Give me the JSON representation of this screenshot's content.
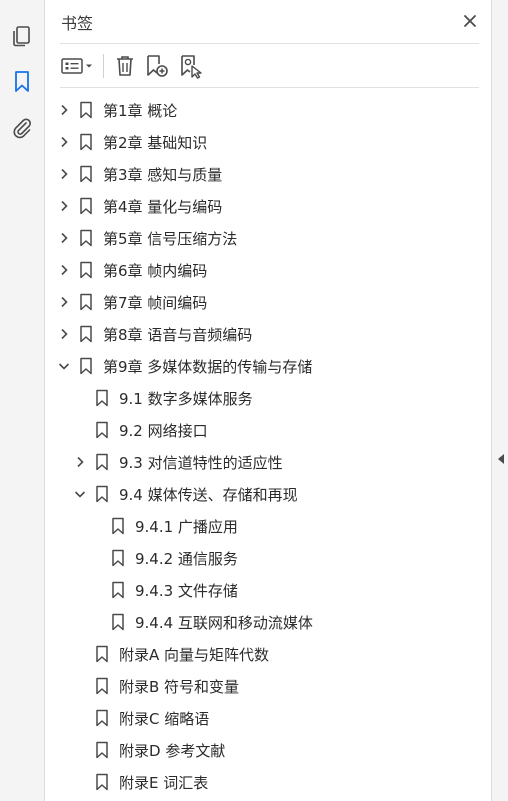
{
  "panel": {
    "title": "书签"
  },
  "bookmarks": [
    {
      "label": "第1章 概论",
      "level": 0,
      "state": "collapsed"
    },
    {
      "label": "第2章 基础知识",
      "level": 0,
      "state": "collapsed"
    },
    {
      "label": "第3章 感知与质量",
      "level": 0,
      "state": "collapsed"
    },
    {
      "label": "第4章 量化与编码",
      "level": 0,
      "state": "collapsed"
    },
    {
      "label": "第5章 信号压缩方法",
      "level": 0,
      "state": "collapsed"
    },
    {
      "label": "第6章 帧内编码",
      "level": 0,
      "state": "collapsed"
    },
    {
      "label": "第7章 帧间编码",
      "level": 0,
      "state": "collapsed"
    },
    {
      "label": "第8章 语音与音频编码",
      "level": 0,
      "state": "collapsed"
    },
    {
      "label": "第9章 多媒体数据的传输与存储",
      "level": 0,
      "state": "expanded"
    },
    {
      "label": "9.1 数字多媒体服务",
      "level": 1,
      "state": "leaf"
    },
    {
      "label": "9.2 网络接口",
      "level": 1,
      "state": "leaf"
    },
    {
      "label": "9.3 对信道特性的适应性",
      "level": 1,
      "state": "collapsed"
    },
    {
      "label": "9.4 媒体传送、存储和再现",
      "level": 1,
      "state": "expanded"
    },
    {
      "label": "9.4.1 广播应用",
      "level": 2,
      "state": "leaf"
    },
    {
      "label": "9.4.2 通信服务",
      "level": 2,
      "state": "leaf"
    },
    {
      "label": "9.4.3 文件存储",
      "level": 2,
      "state": "leaf"
    },
    {
      "label": "9.4.4 互联网和移动流媒体",
      "level": 2,
      "state": "leaf"
    },
    {
      "label": "附录A  向量与矩阵代数",
      "level": 1,
      "state": "leaf"
    },
    {
      "label": "附录B  符号和变量",
      "level": 1,
      "state": "leaf"
    },
    {
      "label": "附录C  缩略语",
      "level": 1,
      "state": "leaf"
    },
    {
      "label": "附录D  参考文献",
      "level": 1,
      "state": "leaf"
    },
    {
      "label": "附录E  词汇表",
      "level": 1,
      "state": "leaf"
    }
  ],
  "icons": {
    "rail": [
      "pages-icon",
      "bookmark-icon",
      "attachment-icon"
    ],
    "toolbar": [
      "options-menu-icon",
      "delete-icon",
      "new-bookmark-icon",
      "new-bookmark-from-structure-icon"
    ]
  },
  "colors": {
    "accent": "#1473e6",
    "icon": "#4b4b4b",
    "text": "#2b2b2b"
  }
}
